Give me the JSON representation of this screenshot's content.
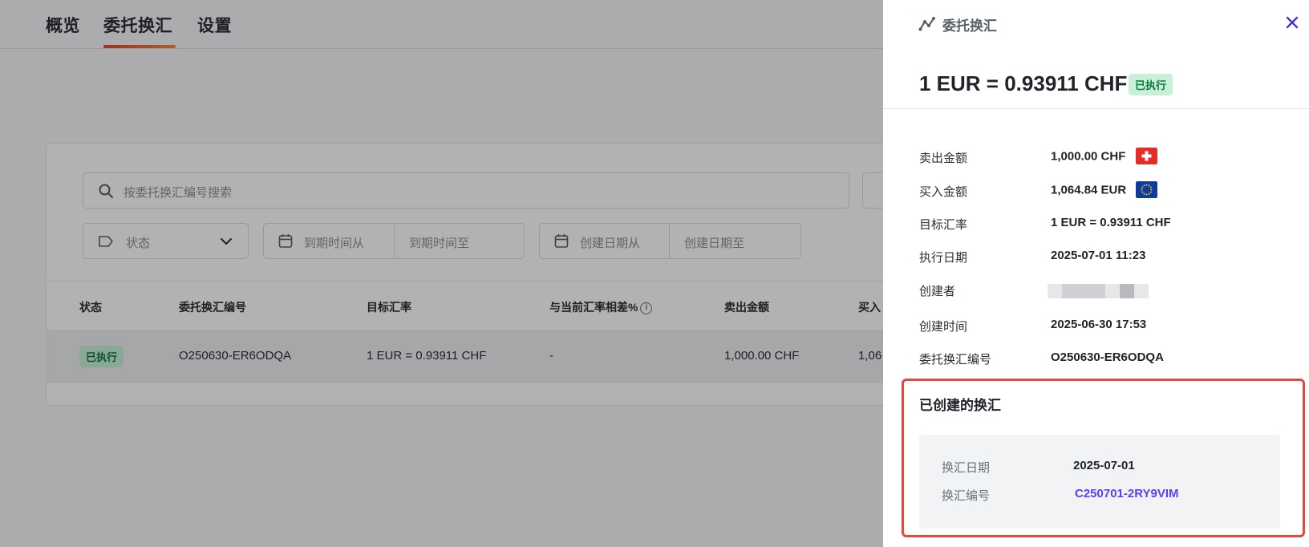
{
  "tabs": [
    {
      "label": "概览"
    },
    {
      "label": "委托换汇"
    },
    {
      "label": "设置"
    }
  ],
  "active_tab": "委托换汇",
  "search": {
    "placeholder": "按委托换汇编号搜索"
  },
  "filters": {
    "status": "状态",
    "due_from": "到期时间从",
    "due_to": "到期时间至",
    "created_from": "创建日期从",
    "created_to": "创建日期至"
  },
  "table": {
    "columns": [
      "状态",
      "委托换汇编号",
      "目标汇率",
      "与当前汇率相差%",
      "卖出金额",
      "买入"
    ],
    "rows": [
      {
        "status": "已执行",
        "order_no": "O250630-ER6ODQA",
        "target_rate": "1 EUR = 0.93911 CHF",
        "diff": "-",
        "sell": "1,000.00 CHF",
        "buy": "1,06"
      }
    ]
  },
  "drawer": {
    "title": "委托换汇",
    "rate": "1 EUR = 0.93911 CHF",
    "status": "已执行",
    "fields": [
      {
        "label": "卖出金额",
        "value": "1,000.00 CHF",
        "flag": "ch-flag-icon"
      },
      {
        "label": "买入金额",
        "value": "1,064.84 EUR",
        "flag": "eu-flag-icon"
      },
      {
        "label": "目标汇率",
        "value": "1 EUR = 0.93911 CHF"
      },
      {
        "label": "执行日期",
        "value": "2025-07-01 11:23"
      },
      {
        "label": "创建者",
        "value": ""
      },
      {
        "label": "创建时间",
        "value": "2025-06-30 17:53"
      },
      {
        "label": "委托换汇编号",
        "value": "O250630-ER6ODQA"
      }
    ],
    "created_conversions": {
      "title": "已创建的换汇",
      "date_label": "换汇日期",
      "date_value": "2025-07-01",
      "id_label": "换汇编号",
      "id_value": "C250701-2RY9VIM"
    }
  },
  "colors": {
    "accent": "#5b3df5",
    "highlight_border": "#e5483d",
    "success_bg": "#c8f0d8",
    "success_text": "#0c7a3e",
    "tab_underline": "#e8412f"
  }
}
